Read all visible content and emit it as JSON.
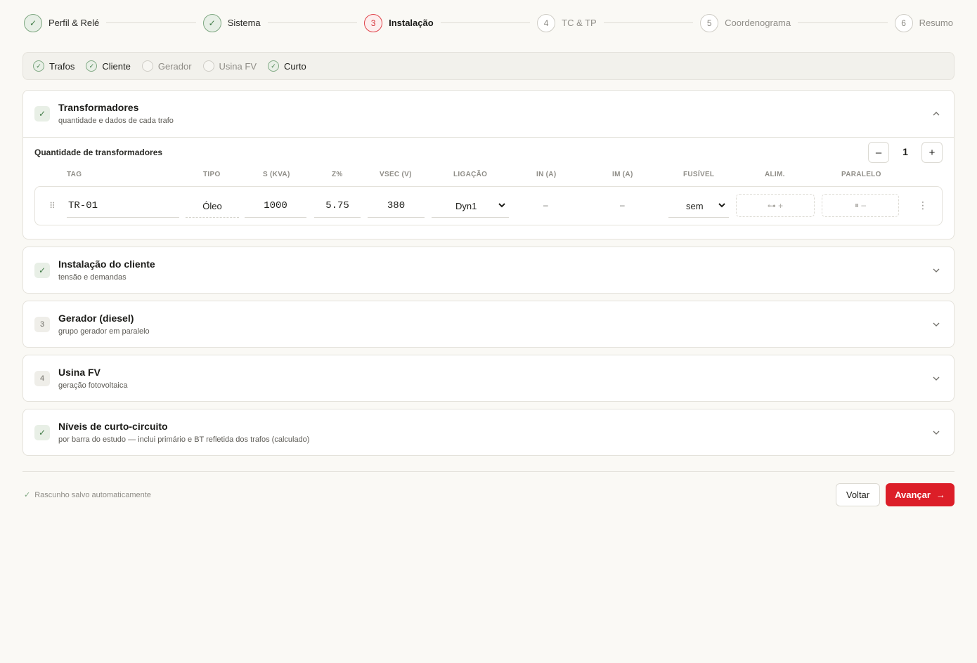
{
  "stepper": {
    "steps": [
      {
        "marker": "✓",
        "label": "Perfil & Relé",
        "state": "done"
      },
      {
        "marker": "✓",
        "label": "Sistema",
        "state": "done"
      },
      {
        "marker": "3",
        "label": "Instalação",
        "state": "current"
      },
      {
        "marker": "4",
        "label": "TC & TP",
        "state": "todo"
      },
      {
        "marker": "5",
        "label": "Coordenograma",
        "state": "todo"
      },
      {
        "marker": "6",
        "label": "Resumo",
        "state": "todo"
      }
    ]
  },
  "subtabs": [
    {
      "label": "Trafos",
      "state": "done",
      "marker": "✓"
    },
    {
      "label": "Cliente",
      "state": "done",
      "marker": "✓"
    },
    {
      "label": "Gerador",
      "state": "todo",
      "marker": ""
    },
    {
      "label": "Usina FV",
      "state": "todo",
      "marker": ""
    },
    {
      "label": "Curto",
      "state": "done",
      "marker": "✓"
    }
  ],
  "sections": {
    "transformers": {
      "badge": "✓",
      "title": "Transformadores",
      "subtitle": "quantidade e dados de cada trafo",
      "quantity_label": "Quantidade de transformadores",
      "quantity": "1",
      "minus": "–",
      "plus": "+",
      "columns": [
        "TAG",
        "TIPO",
        "S (KVA)",
        "Z%",
        "VSEC (V)",
        "LIGAÇÃO",
        "IN (A)",
        "IM (A)",
        "FUSÍVEL",
        "ALIM.",
        "PARALELO"
      ],
      "row": {
        "drag": "⠿",
        "tag": "TR-01",
        "tipo": "Óleo",
        "s_kva": "1000",
        "z_pct": "5.75",
        "vsec": "380",
        "ligacao": "Dyn1",
        "in_a": "–",
        "im_a": "–",
        "fusivel": "sem",
        "alim": "⊶ +",
        "paralelo": "⏸ –",
        "menu": "⋮"
      }
    },
    "cliente": {
      "badge": "✓",
      "title": "Instalação do cliente",
      "subtitle": "tensão e demandas"
    },
    "gerador": {
      "badge": "3",
      "title": "Gerador (diesel)",
      "subtitle": "grupo gerador em paralelo"
    },
    "usina": {
      "badge": "4",
      "title": "Usina FV",
      "subtitle": "geração fotovoltaica"
    },
    "curto": {
      "badge": "✓",
      "title": "Níveis de curto-circuito",
      "subtitle": "por barra do estudo — inclui primário e BT refletida dos trafos (calculado)"
    }
  },
  "footer": {
    "autosave_icon": "✓",
    "autosave": "Rascunho salvo automaticamente",
    "back": "Voltar",
    "next": "Avançar",
    "next_arrow": "→"
  },
  "colors": {
    "accent": "#dc1e28",
    "done": "#3f7a45",
    "background": "#faf9f5"
  }
}
